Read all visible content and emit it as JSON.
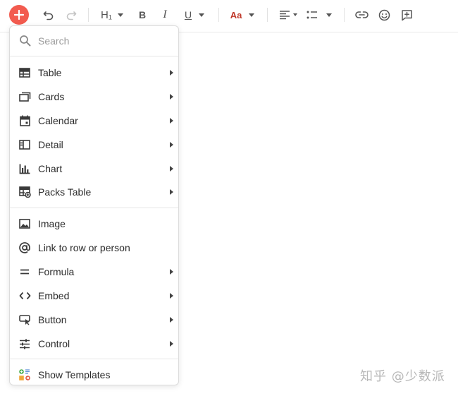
{
  "toolbar": {
    "add_icon": "plus-icon",
    "heading_label": "H₁",
    "bold_label": "B",
    "italic_label": "I",
    "underline_label": "U",
    "text_style_label": "Aa",
    "accent_color": "#f25b4f"
  },
  "menu": {
    "search_placeholder": "Search",
    "groups": [
      [
        {
          "label": "Table",
          "icon": "table-icon",
          "submenu": true
        },
        {
          "label": "Cards",
          "icon": "cards-icon",
          "submenu": true
        },
        {
          "label": "Calendar",
          "icon": "calendar-icon",
          "submenu": true
        },
        {
          "label": "Detail",
          "icon": "detail-icon",
          "submenu": true
        },
        {
          "label": "Chart",
          "icon": "chart-icon",
          "submenu": true
        },
        {
          "label": "Packs Table",
          "icon": "packs-table-icon",
          "submenu": true
        }
      ],
      [
        {
          "label": "Image",
          "icon": "image-icon",
          "submenu": false
        },
        {
          "label": "Link to row or person",
          "icon": "at-icon",
          "submenu": false
        },
        {
          "label": "Formula",
          "icon": "formula-icon",
          "submenu": true
        },
        {
          "label": "Embed",
          "icon": "embed-icon",
          "submenu": true
        },
        {
          "label": "Button",
          "icon": "button-icon",
          "submenu": true
        },
        {
          "label": "Control",
          "icon": "control-icon",
          "submenu": true
        }
      ],
      [
        {
          "label": "Show Templates",
          "icon": "templates-icon",
          "submenu": false
        }
      ]
    ]
  },
  "watermark": "知乎 @少数派"
}
